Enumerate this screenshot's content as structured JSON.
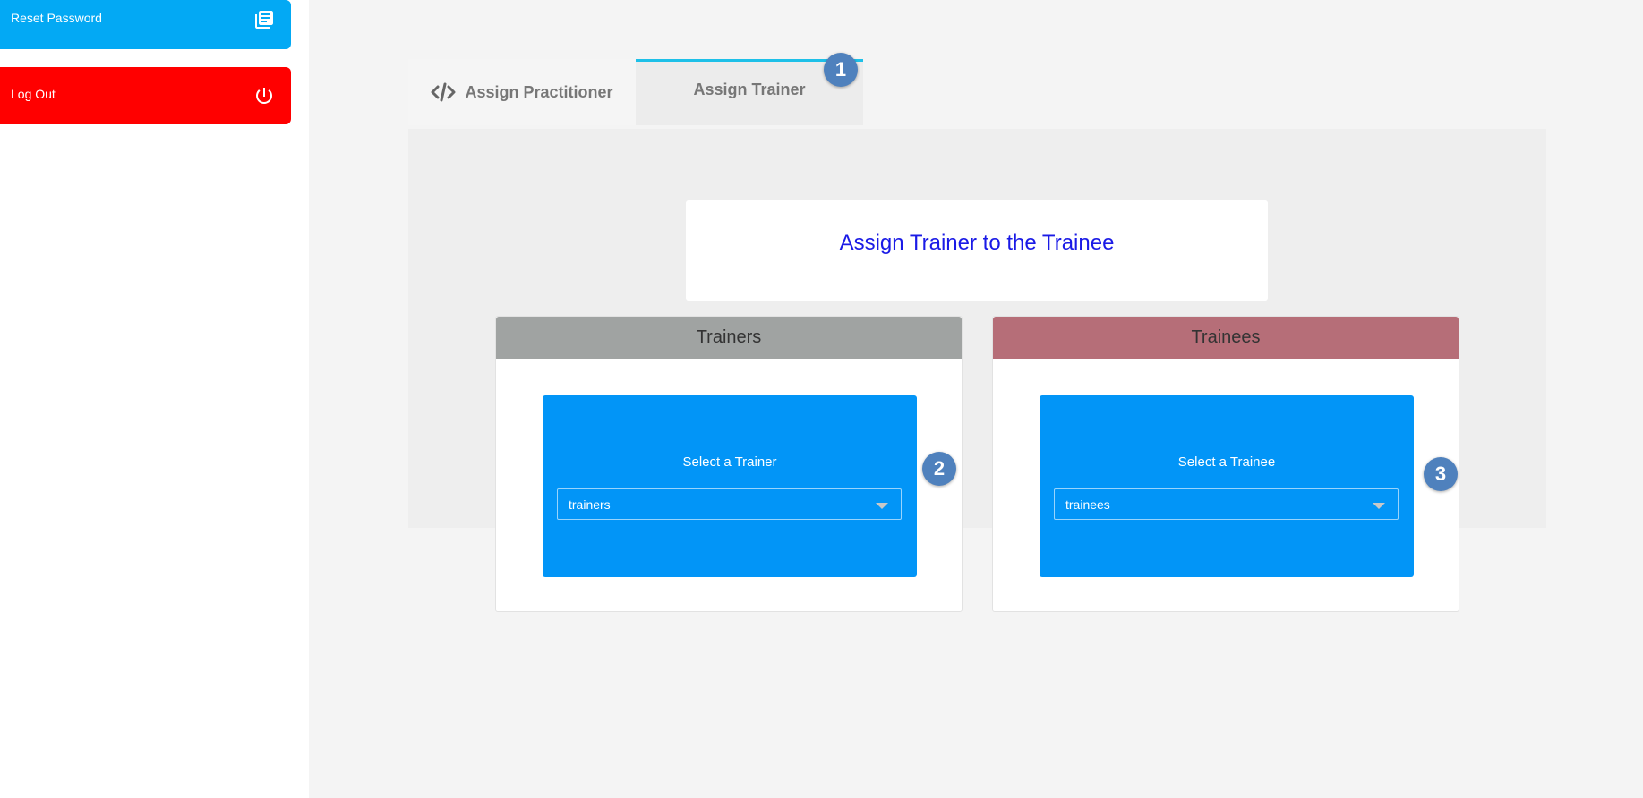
{
  "sidebar": {
    "reset_password": {
      "label": "Reset Password",
      "icon": "library-books-icon"
    },
    "log_out": {
      "label": "Log Out",
      "icon": "power-icon"
    }
  },
  "tabs": [
    {
      "label": "Assign Practitioner",
      "icon": "code-icon",
      "active": false
    },
    {
      "label": "Assign Trainer",
      "active": true
    }
  ],
  "heading": "Assign Trainer to the Trainee",
  "trainers": {
    "header": "Trainers",
    "select_title": "Select a Trainer",
    "selected": "trainers"
  },
  "trainees": {
    "header": "Trainees",
    "select_title": "Select a Trainee",
    "selected": "trainees"
  },
  "badges": [
    "1",
    "2",
    "3"
  ],
  "colors": {
    "reset_button": "#03a9f4",
    "logout_button": "#ff0000",
    "trainers_header": "#a0a3a2",
    "trainees_header": "#b66e78",
    "select_panel": "#0295f7",
    "heading_text": "#1a1ae6",
    "active_tab_accent": "#1ec0e8",
    "badge": "#4f81bd"
  }
}
